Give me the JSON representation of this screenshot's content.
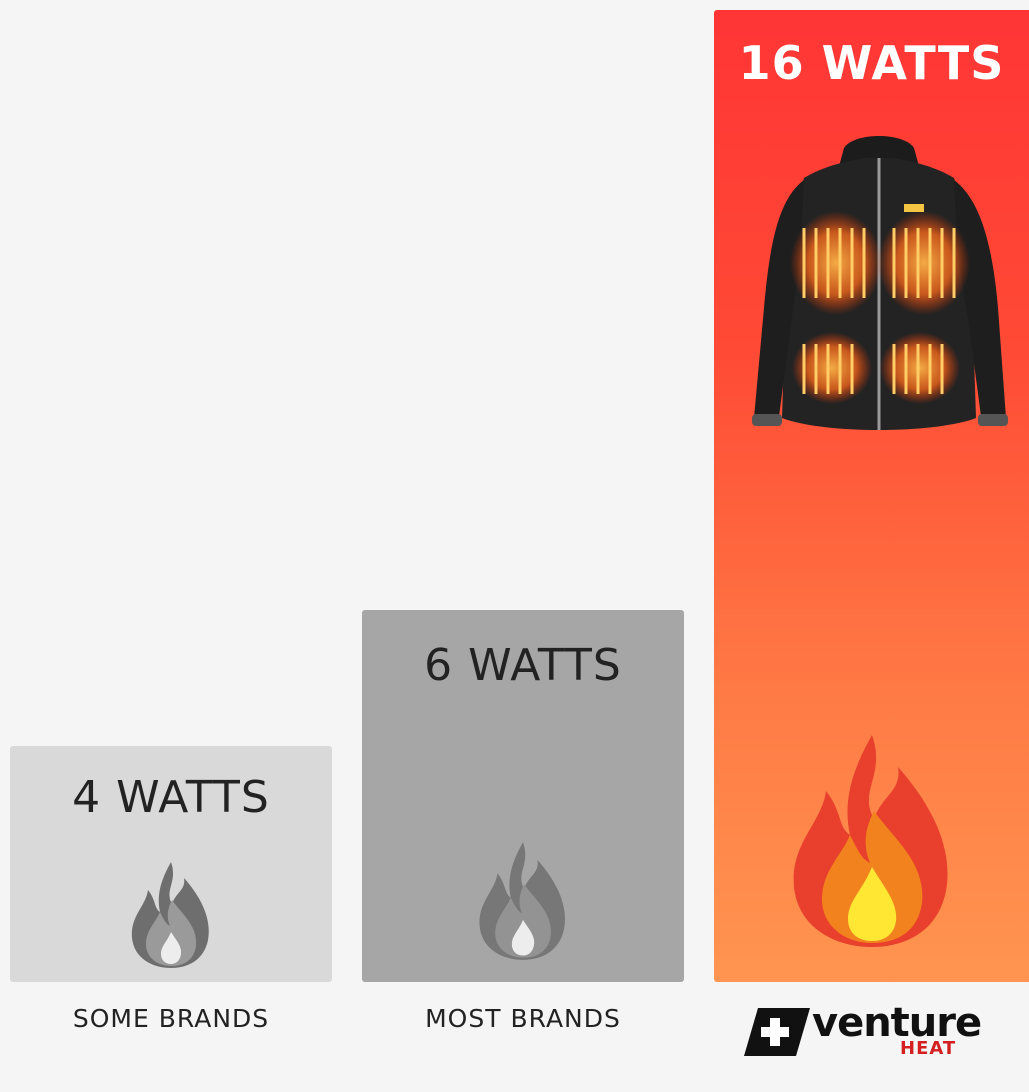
{
  "chart_data": {
    "type": "bar",
    "categories": [
      "SOME BRANDS",
      "MOST BRANDS",
      "venture HEAT"
    ],
    "values": [
      4,
      6,
      16
    ],
    "value_labels": [
      "4 WATTS",
      "6 WATTS",
      "16 WATTS"
    ],
    "ylim": [
      0,
      16
    ],
    "grid": false,
    "colors": [
      "#d9d9d9",
      "#a6a6a6",
      "#ff4a35"
    ]
  },
  "brand": {
    "logo_word": "venture",
    "logo_sub": "HEAT"
  },
  "icons": [
    "flame-icon",
    "heated-jacket-image",
    "venture-cross-logo-icon"
  ]
}
